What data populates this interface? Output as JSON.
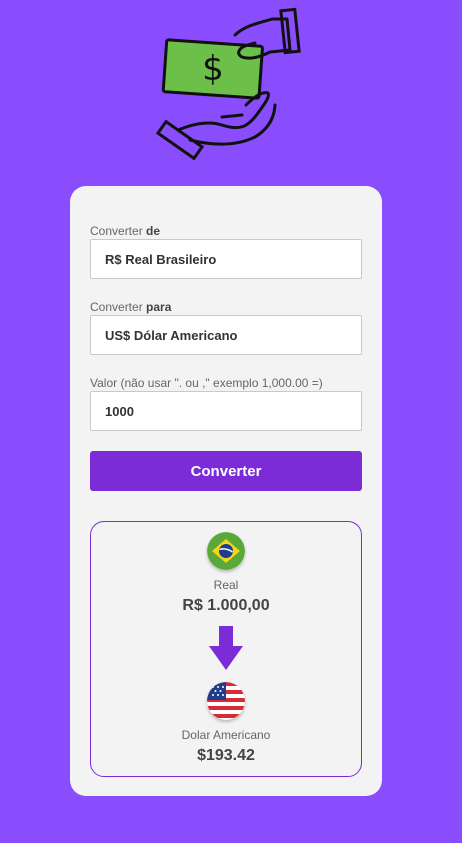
{
  "form": {
    "from_label_prefix": "Converter ",
    "from_label_bold": "de",
    "from_value": "R$ Real Brasileiro",
    "to_label_prefix": "Converter ",
    "to_label_bold": "para",
    "to_value": "US$ Dólar Americano",
    "amount_label": "Valor (não usar \". ou ,\" exemplo 1,000.00 =)",
    "amount_value": "1000",
    "convert_button": "Converter"
  },
  "result": {
    "from_currency_name": "Real",
    "from_currency_value": "R$ 1.000,00",
    "to_currency_name": "Dolar Americano",
    "to_currency_value": "$193.42"
  },
  "colors": {
    "background": "#8a4dfd",
    "accent": "#7b2cd6",
    "card": "#f3f3f3"
  },
  "icons": {
    "hero": "hand-giving-money-icon",
    "from_flag": "brazil-flag-icon",
    "arrow": "arrow-down-icon",
    "to_flag": "usa-flag-icon"
  }
}
